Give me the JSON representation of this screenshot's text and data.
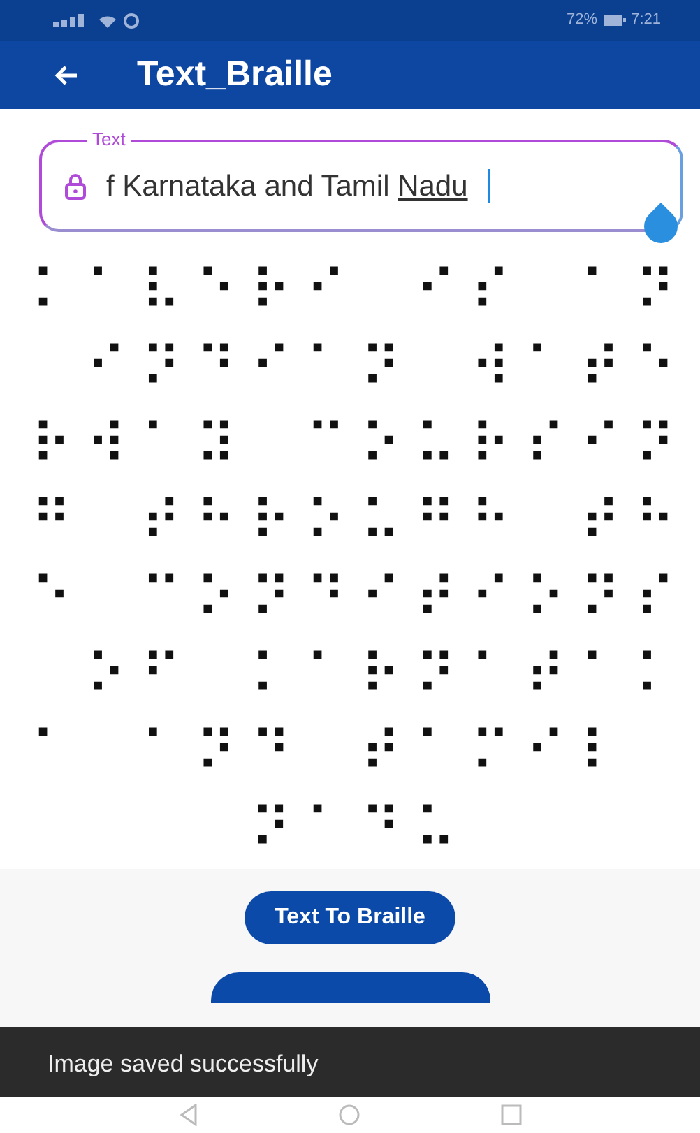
{
  "status_bar": {
    "battery": "72%",
    "time": "7:21"
  },
  "app_bar": {
    "title": "Text_Braille"
  },
  "text_field": {
    "label": "Text",
    "value": "f Karnataka and Tamil",
    "composing": "Nadu"
  },
  "braille_lines": [
    "⠅⠁⠧⠑⠗⠊ ⠊⠎ ⠁⠝",
    " ⠊⠝⠙⠊⠁⠝ ⠺⠁⠞⠑",
    "⠗⠺⠁⠽ ⠉⠕⠥⠗⠎⠊⠝",
    "⠛ ⠞⠓⠗⠕⠥⠛⠓ ⠞⠓",
    "⠑ ⠉⠕⠝⠙⠊⠞⠊⠕⠝⠎",
    " ⠕⠋ ⠅⠁⠗⠝⠁⠞⠁⠅",
    "⠁ ⠁⠝⠙ ⠞⠁⠍⠊⠇",
    "    ⠝⠁⠙⠥"
  ],
  "convert_button": {
    "label": "Text To Braille"
  },
  "snackbar": {
    "message": "Image saved successfully"
  }
}
